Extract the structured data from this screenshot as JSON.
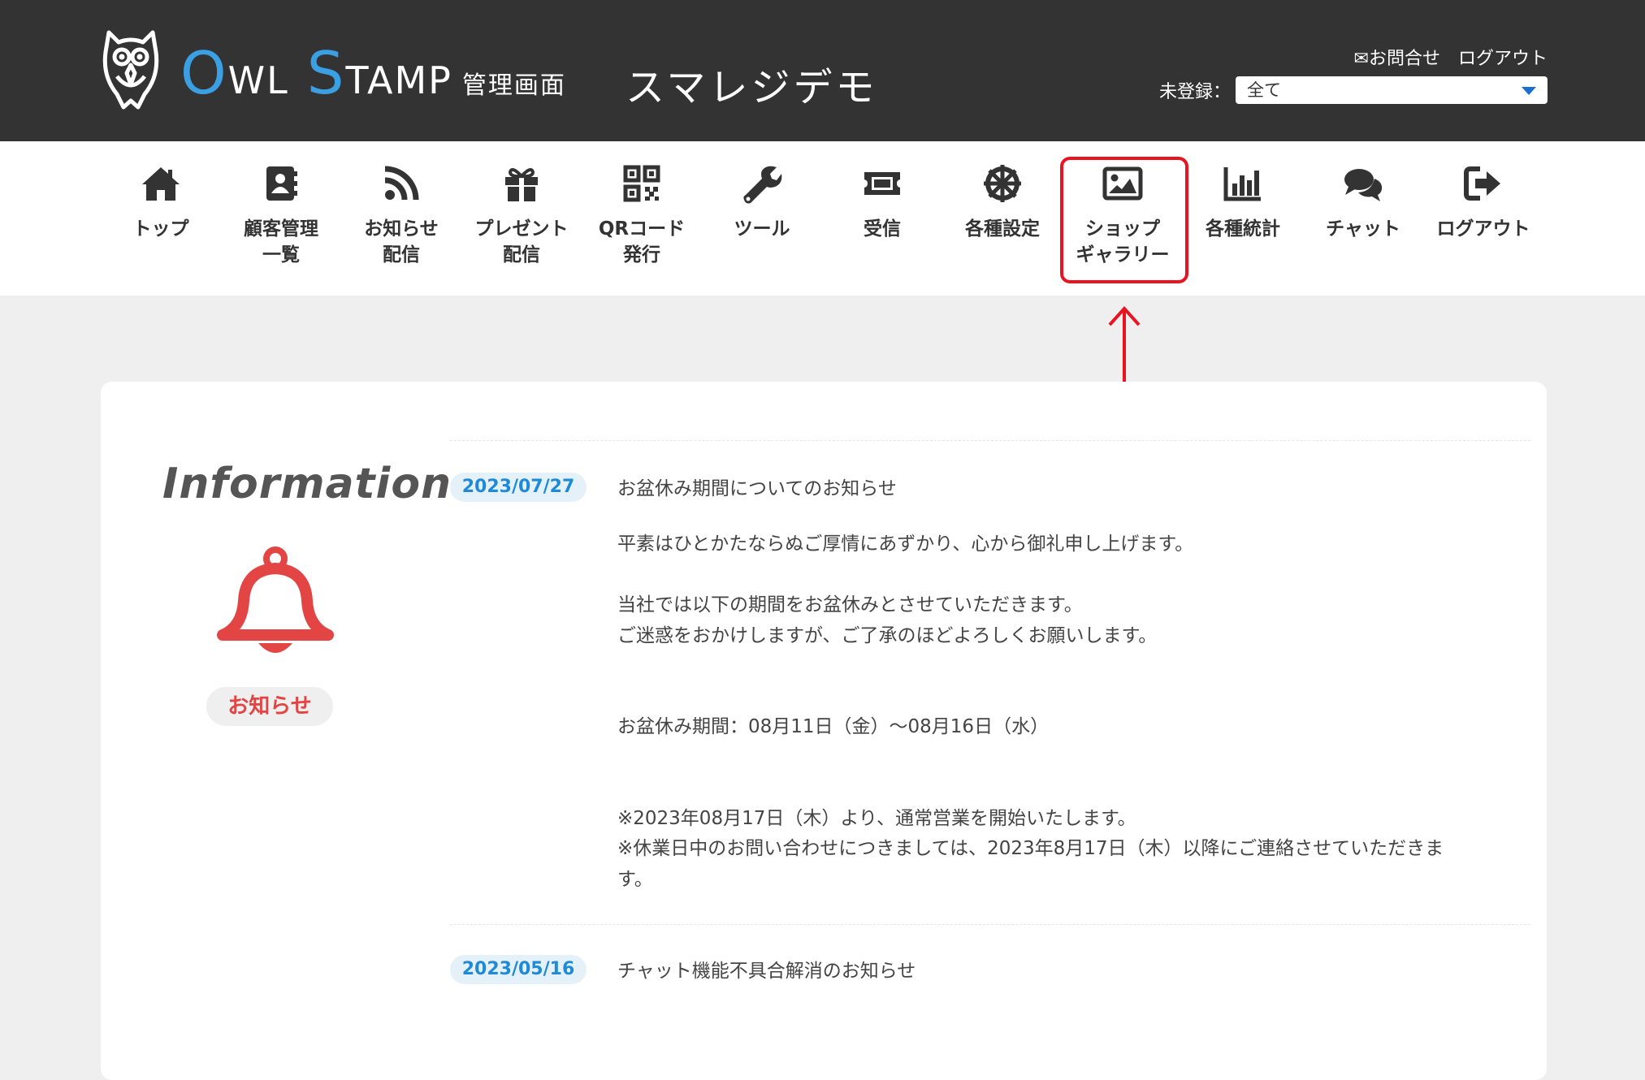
{
  "header": {
    "logo_big_1": "O",
    "logo_small_1": "WL",
    "logo_big_2": "S",
    "logo_small_2": "TAMP",
    "logo_sub": "管理画面",
    "shop_name": "スマレジデモ",
    "contact_link": "✉お問合せ",
    "logout_link": "ログアウト",
    "filter_label": "未登録：",
    "filter_value": "全て"
  },
  "nav": {
    "items": [
      {
        "label": "トップ",
        "icon": "home-icon"
      },
      {
        "label": "顧客管理\n一覧",
        "icon": "address-book-icon"
      },
      {
        "label": "お知らせ\n配信",
        "icon": "rss-icon"
      },
      {
        "label": "プレゼント\n配信",
        "icon": "gift-icon"
      },
      {
        "label": "QRコード\n発行",
        "icon": "qr-code-icon"
      },
      {
        "label": "ツール",
        "icon": "wrench-icon"
      },
      {
        "label": "受信",
        "icon": "ticket-icon"
      },
      {
        "label": "各種設定",
        "icon": "settings-wheel-icon"
      },
      {
        "label": "ショップ\nギャラリー",
        "icon": "image-icon"
      },
      {
        "label": "各種統計",
        "icon": "bar-chart-icon"
      },
      {
        "label": "チャット",
        "icon": "chat-icon"
      },
      {
        "label": "ログアウト",
        "icon": "sign-out-icon"
      }
    ],
    "highlight_color": "#e8141f"
  },
  "info": {
    "title": "Information",
    "badge_label": "お知らせ",
    "news": [
      {
        "date": "2023/07/27",
        "title": "お盆休み期間についてのお知らせ",
        "body": [
          "平素はひとかたならぬご厚情にあずかり、心から御礼申し上げます。",
          "",
          "当社では以下の期間をお盆休みとさせていただきます。",
          "ご迷惑をおかけしますが、ご了承のほどよろしくお願いします。",
          "",
          "",
          "お盆休み期間：08月11日（金）〜08月16日（水）",
          "",
          "",
          "※2023年08月17日（木）より、通常営業を開始いたします。",
          "※休業日中のお問い合わせにつきましては、2023年8月17日（木）以降にご連絡させていただきま",
          "す。"
        ]
      },
      {
        "date": "2023/05/16",
        "title": "チャット機能不具合解消のお知らせ"
      }
    ]
  },
  "colors": {
    "header_bg": "#333333",
    "logo_blue": "#3a9fe3",
    "date_text": "#1f8ad6",
    "bell_red": "#e34545"
  }
}
